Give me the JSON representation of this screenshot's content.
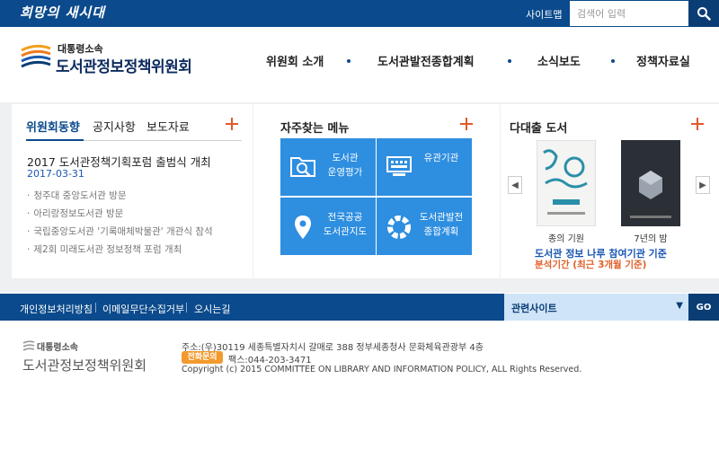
{
  "topbar": {
    "slogan": "희망의 새시대",
    "sitemap_label": "사이트맵",
    "search_placeholder": "검색어 입력"
  },
  "header": {
    "logo_small": "대통령소속",
    "logo_big": "도서관정보정책위원회",
    "nav": [
      "위원회 소개",
      "도서관발전종합계획",
      "소식보도",
      "정책자료실"
    ]
  },
  "news": {
    "tabs": [
      "위원회동향",
      "공지사항",
      "보도자료"
    ],
    "headline": "2017 도서관정책기획포럼 출범식 개최",
    "headline_date": "2017-03-31",
    "items": [
      "청주대 중앙도서관 방문",
      "아리랑정보도서관 방문",
      "국립중앙도서관 '기록매체박물관' 개관식 참석",
      "제2회 미래도서관 정보정책 포럼 개최"
    ]
  },
  "quick_menu": {
    "title": "자주찾는 메뉴",
    "items": [
      {
        "label": "도서관\n운영평가",
        "icon": "search-folder-icon"
      },
      {
        "label": "유관기관",
        "icon": "keyboard-icon"
      },
      {
        "label": "전국공공\n도서관지도",
        "icon": "map-pin-icon"
      },
      {
        "label": "도서관발전\n종합계획",
        "icon": "ring-icon"
      }
    ]
  },
  "books": {
    "title": "다대출 도서",
    "items": [
      {
        "title": "종의 기원",
        "cover_color": "#f4f4f2"
      },
      {
        "title": "7년의 밤",
        "cover_color": "#2b2f36"
      }
    ],
    "subtitle1": "도서관 정보 나루 참여기관 기준",
    "subtitle2": "분석기간 (최근 3개월 기준)"
  },
  "footer_nav": {
    "links": [
      "개인정보처리방침",
      "이메일무단수집거부",
      "오시는길"
    ],
    "related_label": "관련사이트",
    "go_label": "GO"
  },
  "footer": {
    "logo_small": "대통령소속",
    "logo_big": "도서관정보정책위원회",
    "address": "주소:(우)30119 세종특별자치시 갈매로 388 정부세종청사 문화체육관광부 4층",
    "tel_label": "전화문의",
    "fax": "팩스:044-203-3471",
    "copyright": "Copyright (c) 2015 COMMITTEE ON LIBRARY AND INFORMATION POLICY, ALL Rights Reserved."
  },
  "colors": {
    "primary": "#0b4a8c",
    "accent_orange": "#e05a2a",
    "tile_blue": "#2e8ee0"
  }
}
